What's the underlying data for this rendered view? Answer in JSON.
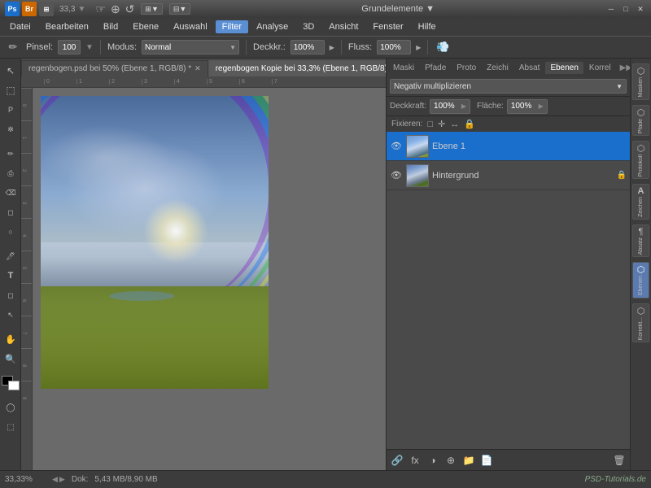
{
  "titlebar": {
    "workspace": "Grundelemente",
    "dropdown_arrow": "▼",
    "minimize": "─",
    "restore": "□",
    "close": "✕"
  },
  "menubar": {
    "items": [
      "Datei",
      "Bearbeiten",
      "Bild",
      "Ebene",
      "Auswahl",
      "Filter",
      "Analyse",
      "3D",
      "Ansicht",
      "Fenster",
      "Hilfe"
    ]
  },
  "optionsbar": {
    "brush_icon": "✏",
    "pinsel_label": "Pinsel:",
    "brush_size": "100",
    "modus_label": "Modus:",
    "modus_value": "Normal",
    "deckkraft_label": "Deckkr.:",
    "deckkraft_value": "100%",
    "fluss_label": "Fluss:",
    "fluss_value": "100%",
    "airbrush_icon": "💨"
  },
  "tabs": [
    {
      "label": "regenbogen.psd bei 50% (Ebene 1, RGB/8) *",
      "active": false
    },
    {
      "label": "regenbogen Kopie bei 33,3% (Ebene 1, RGB/8) *",
      "active": true
    }
  ],
  "panels": {
    "tabs": [
      "Maski",
      "Pfade",
      "Proto",
      "Zeichi",
      "Absat",
      "Ebenen",
      "Korrel"
    ],
    "active_tab": "Ebenen",
    "more_icon": "▶▶"
  },
  "layers": {
    "blend_mode": "Negativ multiplizieren",
    "opacity_label": "Deckkraft:",
    "opacity_value": "100%",
    "fill_label": "Fläche:",
    "fill_value": "100%",
    "fixieren_label": "Fixieren:",
    "lock_icons": [
      "□",
      "✛",
      "↔",
      "🔒"
    ],
    "items": [
      {
        "name": "Ebene 1",
        "visible": true,
        "active": true,
        "locked": false
      },
      {
        "name": "Hintergrund",
        "visible": true,
        "active": false,
        "locked": true
      }
    ],
    "bottom_icons": [
      "🔗",
      "fx",
      "◑",
      "🗑",
      "📄",
      "📁"
    ]
  },
  "right_sidebar": {
    "sections": [
      {
        "label": "Masken",
        "icon": "⬡",
        "active": false
      },
      {
        "label": "Pfade",
        "icon": "⬡",
        "active": false
      },
      {
        "label": "Protokoll",
        "icon": "⬡",
        "active": false
      },
      {
        "label": "Zeichen",
        "icon": "A",
        "active": false
      },
      {
        "label": "Absatz",
        "icon": "¶",
        "active": false
      },
      {
        "label": "Ebenen",
        "icon": "⬡",
        "active": true
      },
      {
        "label": "Korrekt...",
        "icon": "⬡",
        "active": false
      }
    ]
  },
  "statusbar": {
    "zoom": "33,33%",
    "doc_label": "Dok:",
    "doc_value": "5,43 MB/8,90 MB",
    "watermark": "PSD-Tutorials.de"
  },
  "toolbox": {
    "tools": [
      {
        "icon": "↖",
        "name": "move"
      },
      {
        "icon": "⬚",
        "name": "marquee"
      },
      {
        "icon": "✂",
        "name": "lasso"
      },
      {
        "icon": "✲",
        "name": "quick-select"
      },
      {
        "icon": "✏",
        "name": "brush"
      },
      {
        "icon": "⎙",
        "name": "stamp"
      },
      {
        "icon": "⌫",
        "name": "eraser"
      },
      {
        "icon": "◻",
        "name": "gradient"
      },
      {
        "icon": "🔍",
        "name": "zoom"
      },
      {
        "icon": "✋",
        "name": "hand"
      },
      {
        "icon": "T",
        "name": "text"
      },
      {
        "icon": "◻",
        "name": "shape"
      },
      {
        "icon": "🖊",
        "name": "pen"
      }
    ]
  }
}
